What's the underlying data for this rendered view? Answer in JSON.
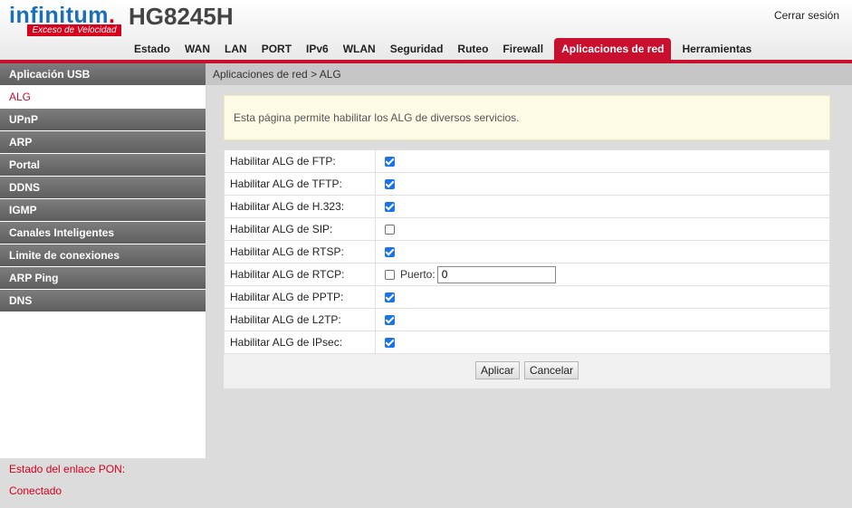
{
  "brand": {
    "logo_text": "infinitum",
    "logo_dot": ".",
    "tagline": "Exceso de Velocidad",
    "model": "HG8245H"
  },
  "header": {
    "logout_label": "Cerrar sesión"
  },
  "nav": [
    "Estado",
    "WAN",
    "LAN",
    "PORT",
    "IPv6",
    "WLAN",
    "Seguridad",
    "Ruteo",
    "Firewall",
    "Aplicaciones de red",
    "Herramientas"
  ],
  "nav_active": "Aplicaciones de red",
  "sidebar": {
    "items": [
      "Aplicación USB",
      "ALG",
      "UPnP",
      "ARP",
      "Portal",
      "DDNS",
      "IGMP",
      "Canales Inteligentes",
      "Limite de conexiones",
      "ARP Ping",
      "DNS"
    ],
    "active": "ALG"
  },
  "status": {
    "label": "Estado del enlace PON:",
    "value": "Conectado"
  },
  "breadcrumb": "Aplicaciones de red > ALG",
  "info_text": "Esta página permite habilitar los ALG de diversos servicios.",
  "form": {
    "rows": [
      {
        "label": "Habilitar ALG de FTP:",
        "checked": true
      },
      {
        "label": "Habilitar ALG de TFTP:",
        "checked": true
      },
      {
        "label": "Habilitar ALG de H.323:",
        "checked": true
      },
      {
        "label": "Habilitar ALG de SIP:",
        "checked": false
      },
      {
        "label": "Habilitar ALG de RTSP:",
        "checked": true
      },
      {
        "label": "Habilitar ALG de RTCP:",
        "checked": false,
        "port_label": "Puerto:",
        "port_value": "0"
      },
      {
        "label": "Habilitar ALG de PPTP:",
        "checked": true
      },
      {
        "label": "Habilitar ALG de L2TP:",
        "checked": true
      },
      {
        "label": "Habilitar ALG de IPsec:",
        "checked": true
      }
    ],
    "apply_label": "Aplicar",
    "cancel_label": "Cancelar"
  },
  "colors": {
    "accent": "#c8102e",
    "brand_blue": "#1b6fb6",
    "checkbox": "#1a73e8"
  }
}
